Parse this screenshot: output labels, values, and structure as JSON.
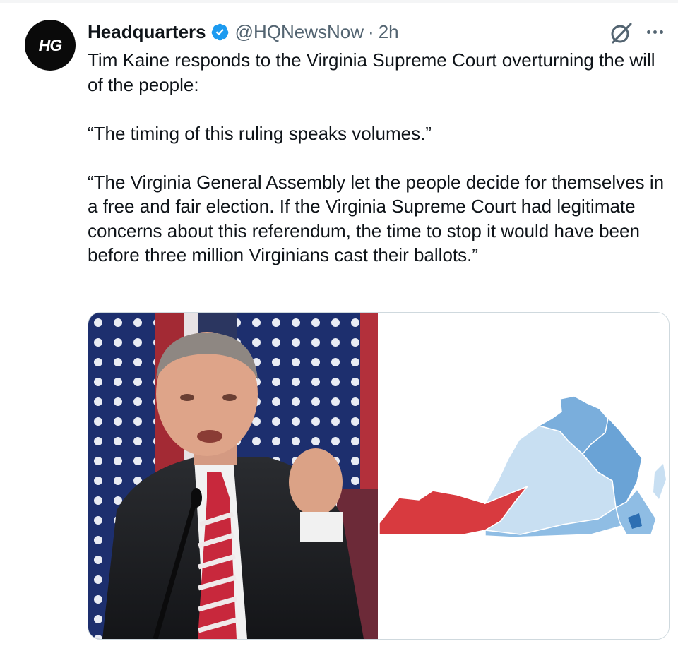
{
  "post": {
    "avatar_text": "HG",
    "display_name": "Headquarters",
    "handle": "@HQNewsNow",
    "separator": "·",
    "time": "2h",
    "text_paragraphs": [
      "Tim Kaine responds to the Virginia Supreme Court overturning the will of the people:",
      "“The timing of this ruling speaks volumes.”",
      "“The Virginia General Assembly let the people decide for themselves in a free and fair election. If the Virginia Supreme Court had legitimate concerns about this referendum, the time to stop it would have been before three million Virginians cast their ballots.”"
    ]
  },
  "icons": {
    "verified": "verified-badge-icon",
    "grok": "grok-icon",
    "more": "more-icon"
  },
  "colors": {
    "verified_blue": "#1d9bf0",
    "secondary_text": "#536471",
    "map_red": "#d83a3f",
    "map_light_blue": "#c8dff2",
    "map_mid_blue": "#8fbde4",
    "map_dark_blue": "#4e90cf"
  }
}
